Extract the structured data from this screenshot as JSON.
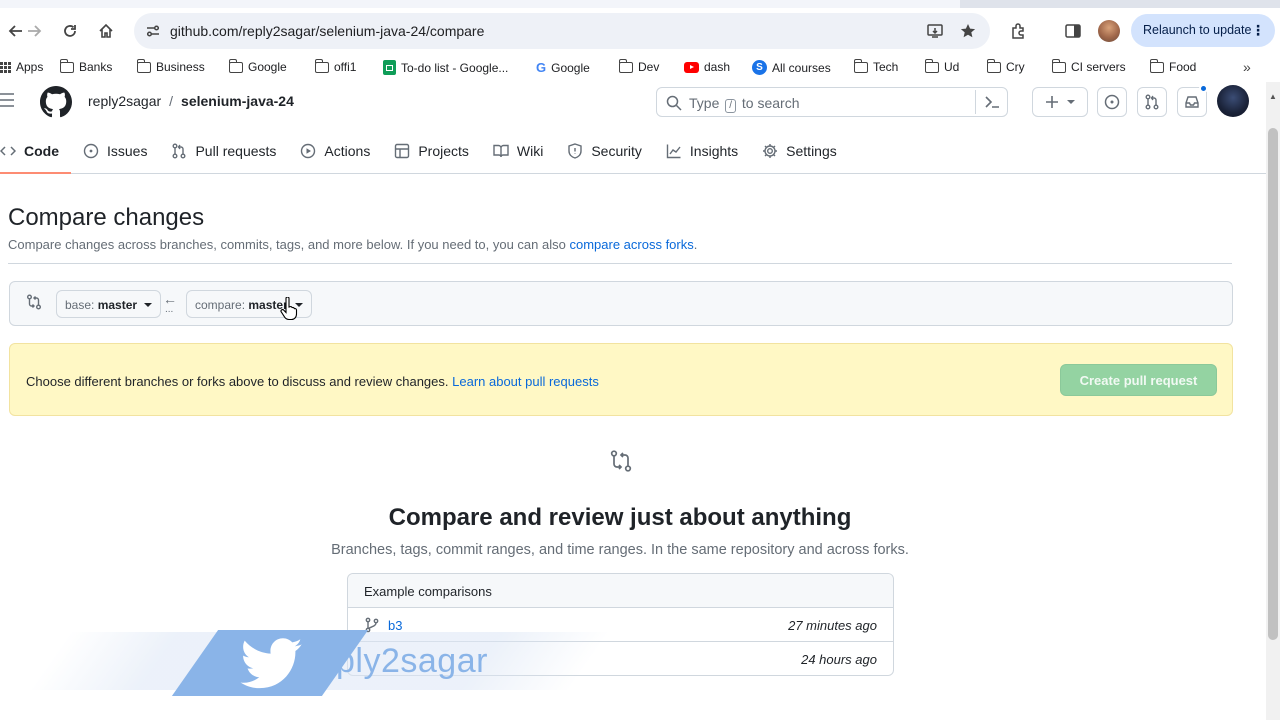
{
  "browser": {
    "url": "github.com/reply2sagar/selenium-java-24/compare",
    "relaunch_label": "Relaunch to update",
    "bookmarks": [
      {
        "label": "Apps",
        "icon": "apps-grid-icon"
      },
      {
        "label": "Banks",
        "icon": "folder-icon"
      },
      {
        "label": "Business",
        "icon": "folder-icon"
      },
      {
        "label": "Google",
        "icon": "folder-icon"
      },
      {
        "label": "offi1",
        "icon": "folder-icon"
      },
      {
        "label": "To-do list - Google...",
        "icon": "google-sheets-icon"
      },
      {
        "label": "Google",
        "icon": "google-g-icon"
      },
      {
        "label": "Dev",
        "icon": "folder-icon"
      },
      {
        "label": "dash",
        "icon": "youtube-icon"
      },
      {
        "label": "All courses",
        "icon": "s-logo-icon"
      },
      {
        "label": "Tech",
        "icon": "folder-icon"
      },
      {
        "label": "Ud",
        "icon": "folder-icon"
      },
      {
        "label": "Cry",
        "icon": "folder-icon"
      },
      {
        "label": "CI servers",
        "icon": "folder-icon"
      },
      {
        "label": "Food",
        "icon": "folder-icon"
      }
    ]
  },
  "header": {
    "owner": "reply2sagar",
    "separator": "/",
    "repo": "selenium-java-24",
    "search_prefix": "Type",
    "search_key": "/",
    "search_suffix": "to search"
  },
  "repo_nav": [
    {
      "label": "Code",
      "icon": "code-icon",
      "active": true
    },
    {
      "label": "Issues",
      "icon": "issue-opened-icon"
    },
    {
      "label": "Pull requests",
      "icon": "git-pull-request-icon"
    },
    {
      "label": "Actions",
      "icon": "play-icon"
    },
    {
      "label": "Projects",
      "icon": "table-icon"
    },
    {
      "label": "Wiki",
      "icon": "book-icon"
    },
    {
      "label": "Security",
      "icon": "shield-icon"
    },
    {
      "label": "Insights",
      "icon": "graph-icon"
    },
    {
      "label": "Settings",
      "icon": "gear-icon"
    }
  ],
  "compare": {
    "title": "Compare changes",
    "subtitle": "Compare changes across branches, commits, tags, and more below. If you need to, you can also",
    "subtitle_link": "compare across forks",
    "subtitle_end": ".",
    "base_prefix": "base:",
    "base_branch": "master",
    "compare_prefix": "compare:",
    "compare_branch": "master"
  },
  "flash": {
    "text": "Choose different branches or forks above to discuss and review changes.",
    "link": "Learn about pull requests",
    "button": "Create pull request"
  },
  "blankslate": {
    "title": "Compare and review just about anything",
    "subtitle": "Branches, tags, commit ranges, and time ranges. In the same repository and across forks."
  },
  "examples": {
    "heading": "Example comparisons",
    "rows": [
      {
        "branch": "b3",
        "time": "27 minutes ago"
      },
      {
        "branch": "",
        "time": "24 hours ago"
      }
    ]
  },
  "watermark": {
    "text": "ply2sagar"
  },
  "colors": {
    "link": "#0969da",
    "flash_bg": "#fff8c5",
    "create_pr_disabled": "#94d3a2",
    "active_tab_underline": "#fd8c73"
  }
}
